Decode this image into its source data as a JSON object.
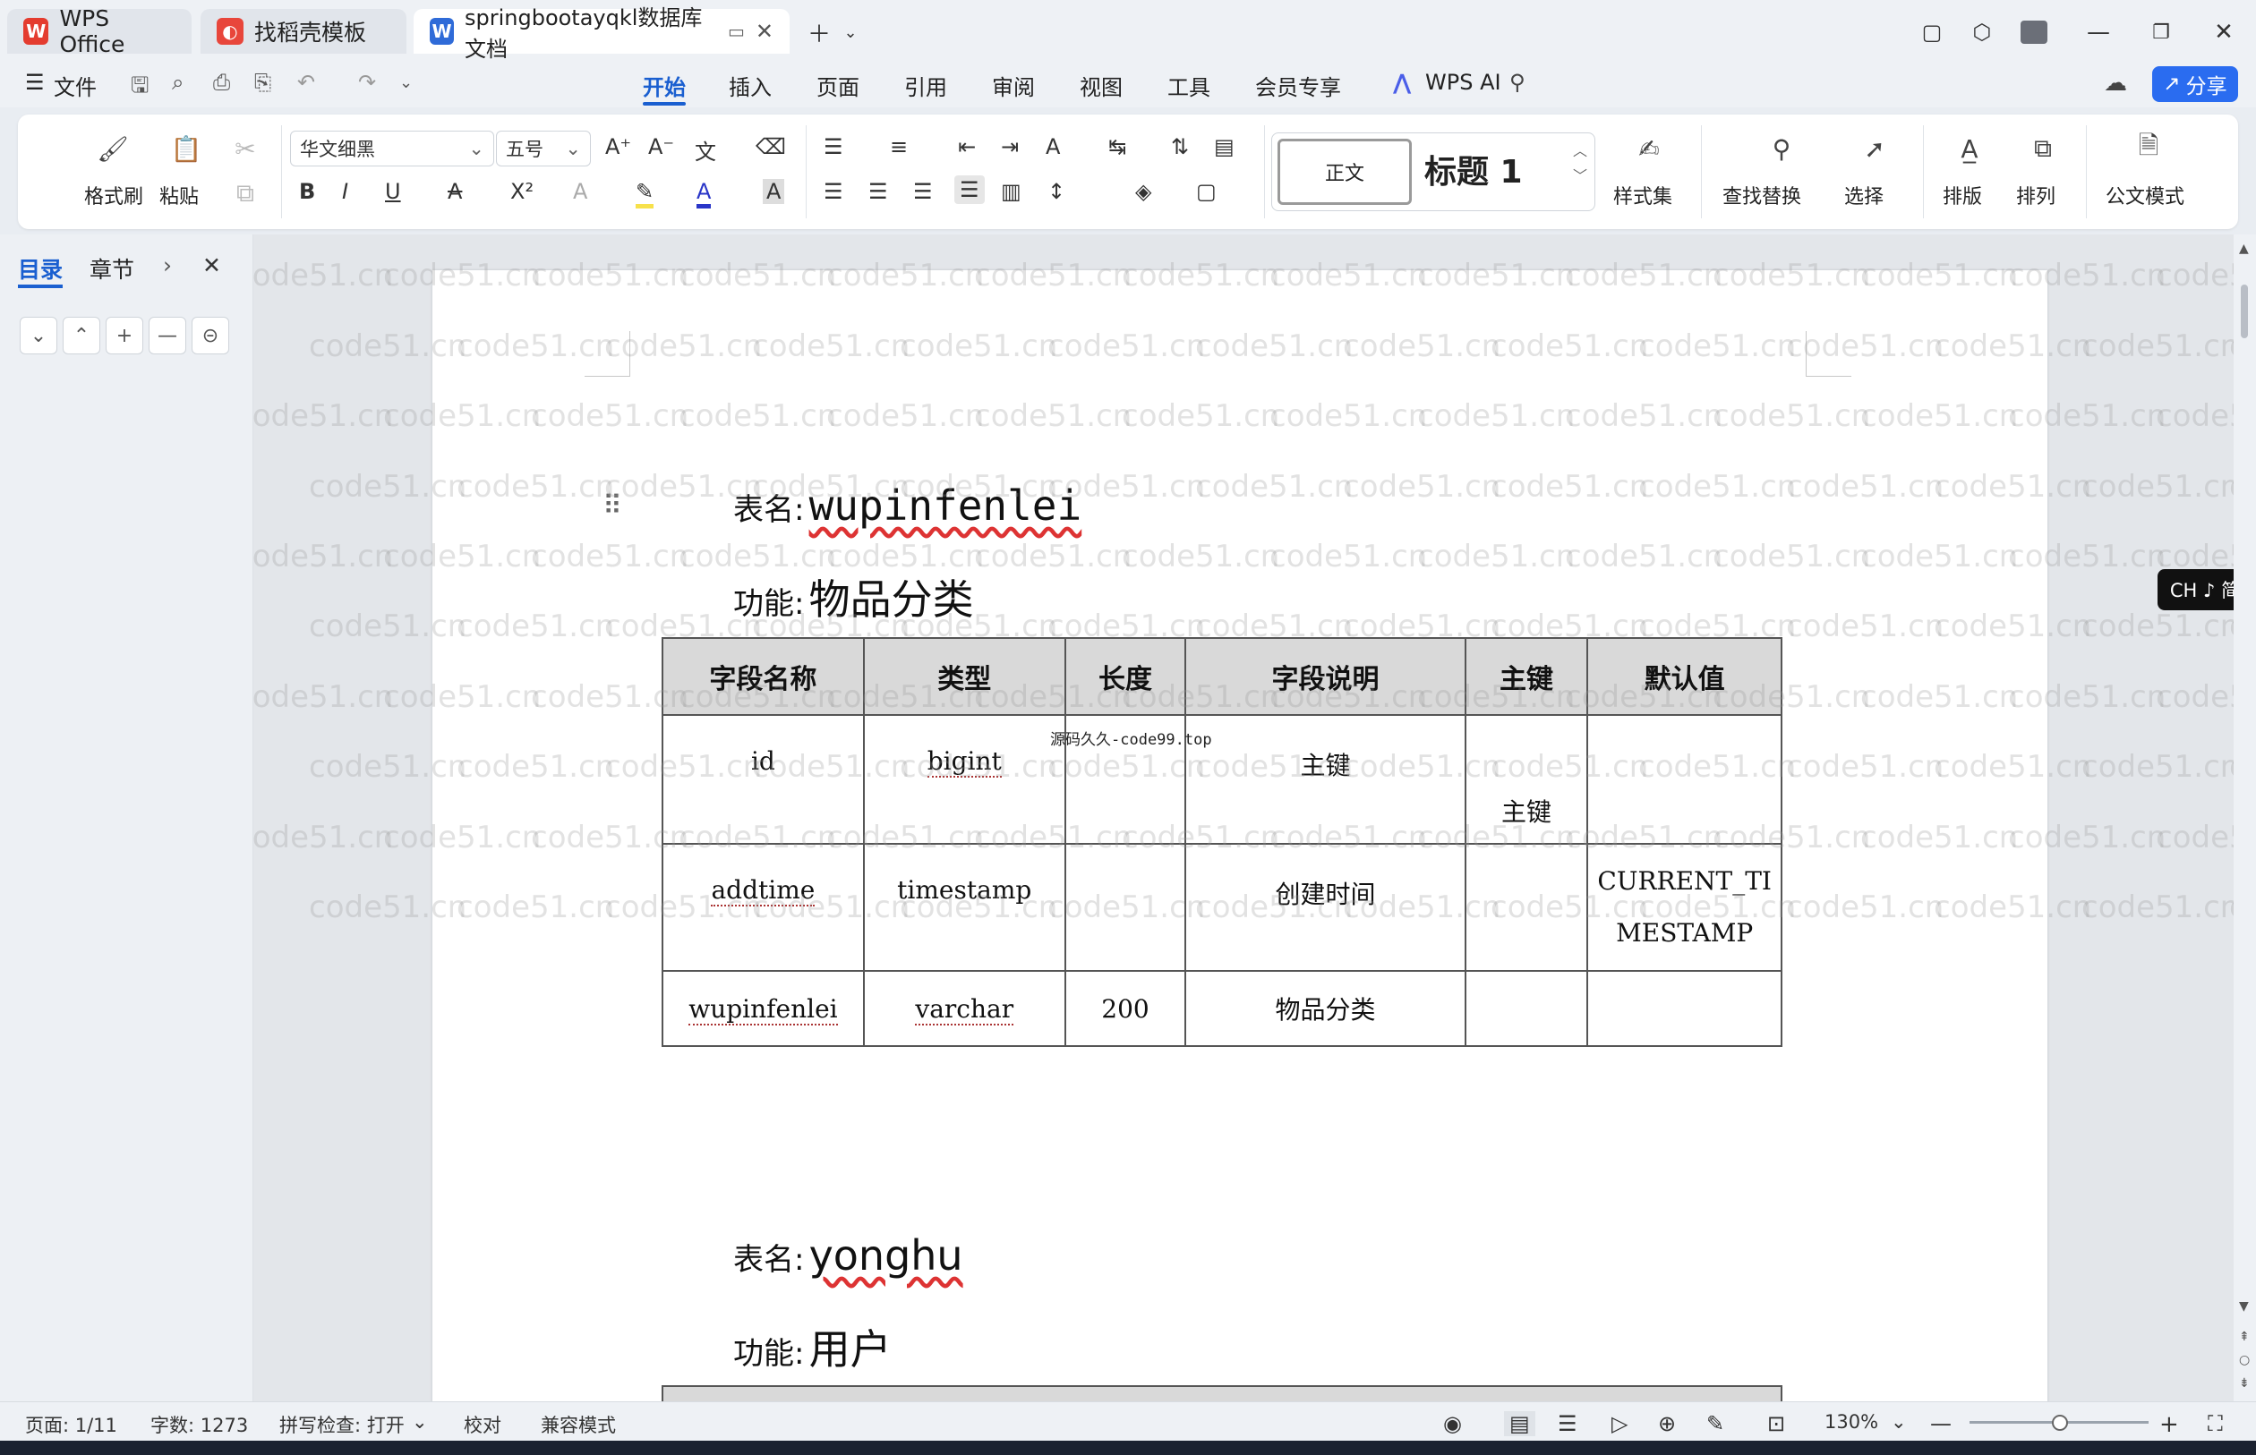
{
  "tabs": {
    "wps_office": "WPS Office",
    "template": "找稻壳模板",
    "document": "springbootayqkl数据库文档"
  },
  "menu": {
    "file": "文件",
    "items": [
      "开始",
      "插入",
      "页面",
      "引用",
      "审阅",
      "视图",
      "工具",
      "会员专享"
    ],
    "wps_ai": "WPS AI",
    "share": "分享"
  },
  "ribbon": {
    "format_painter": "格式刷",
    "paste": "粘贴",
    "font_name": "华文细黑",
    "font_size": "五号",
    "style_normal": "正文",
    "style_heading": "标题 1",
    "styles": "样式集",
    "find_replace": "查找替换",
    "select": "选择",
    "layout": "排版",
    "arrange": "排列",
    "official_mode": "公文模式"
  },
  "left_panel": {
    "tab_toc": "目录",
    "tab_sections": "章节"
  },
  "document": {
    "table_label": "表名:",
    "func_label": "功能:",
    "stamp": "源码久久-code99.top",
    "sections": [
      {
        "table_name": "wupinfenlei",
        "function": "物品分类",
        "headers": [
          "字段名称",
          "类型",
          "长度",
          "字段说明",
          "主键",
          "默认值"
        ],
        "rows": [
          [
            "id",
            "bigint",
            "",
            "主键",
            "主键",
            ""
          ],
          [
            "addtime",
            "timestamp",
            "",
            "创建时间",
            "",
            "CURRENT_TIMESTAMP"
          ],
          [
            "wupinfenlei",
            "varchar",
            "200",
            "物品分类",
            "",
            ""
          ]
        ]
      },
      {
        "table_name": "yonghu",
        "function": "用户"
      }
    ]
  },
  "watermark": "code51.cn",
  "ime": "CH ♪ 简",
  "status": {
    "page": "页面: 1/11",
    "words": "字数: 1273",
    "spell": "拼写检查: 打开",
    "proof": "校对",
    "compat": "兼容模式",
    "zoom": "130%"
  }
}
